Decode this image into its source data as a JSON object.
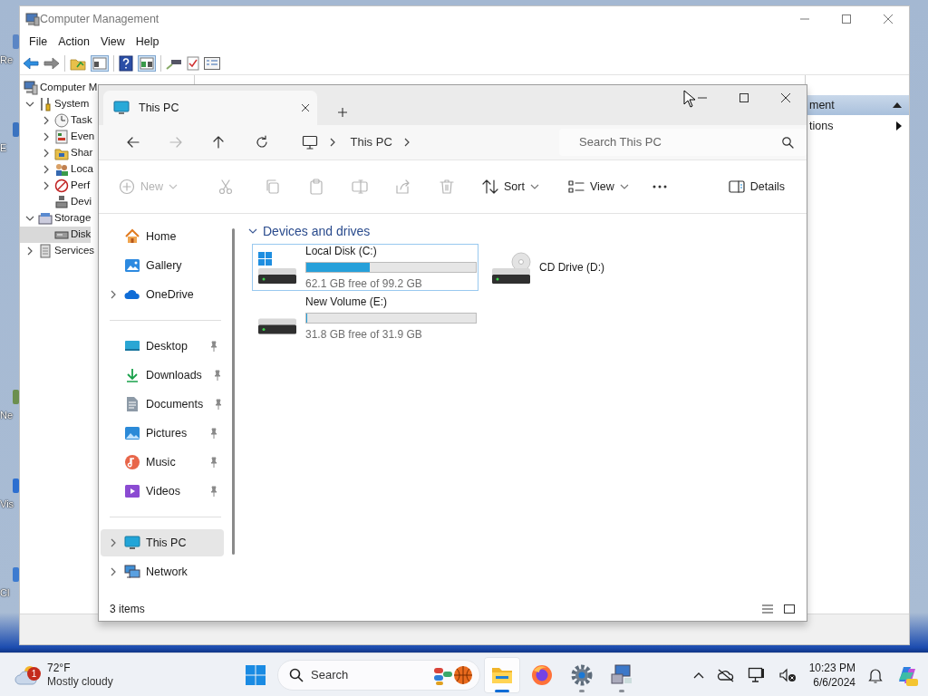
{
  "desktop": {
    "shortcut_labels": [
      "Re",
      "E",
      "Ne",
      "Vis",
      "Cl"
    ]
  },
  "computer_management": {
    "title": "Computer Management",
    "menu": [
      "File",
      "Action",
      "View",
      "Help"
    ],
    "tree": [
      {
        "label": "Computer M",
        "kind": "computer",
        "selected": false,
        "children": [
          {
            "label": "System",
            "kind": "tools",
            "expanded": true,
            "selected": false,
            "children": [
              {
                "label": "Task",
                "kind": "clock",
                "expanded": false,
                "selected": false
              },
              {
                "label": "Even",
                "kind": "event",
                "expanded": false,
                "selected": false
              },
              {
                "label": "Shar",
                "kind": "share",
                "expanded": false,
                "selected": false
              },
              {
                "label": "Loca",
                "kind": "users",
                "expanded": false,
                "selected": false
              },
              {
                "label": "Perf",
                "kind": "perf",
                "expanded": false,
                "selected": false
              },
              {
                "label": "Devi",
                "kind": "device",
                "selected": false
              }
            ]
          },
          {
            "label": "Storage",
            "kind": "storage",
            "expanded": true,
            "selected": false,
            "children": [
              {
                "label": "Disk",
                "kind": "disk",
                "selected": true
              }
            ]
          },
          {
            "label": "Services",
            "kind": "services",
            "expanded": false,
            "selected": false
          }
        ]
      }
    ],
    "actions": [
      {
        "label": "ment",
        "kind": "header"
      },
      {
        "label": "tions",
        "kind": "item"
      }
    ]
  },
  "explorer": {
    "tabs": [
      {
        "label": "This PC",
        "selected": true
      }
    ],
    "breadcrumb": [
      "This PC"
    ],
    "search": {
      "placeholder": "Search This PC"
    },
    "commands": [
      {
        "kind": "new",
        "label": "New",
        "disabled": true,
        "dropdown": true
      },
      {
        "kind": "cut",
        "disabled": true
      },
      {
        "kind": "copy",
        "disabled": true
      },
      {
        "kind": "paste",
        "disabled": true
      },
      {
        "kind": "rename",
        "disabled": true
      },
      {
        "kind": "share",
        "disabled": true
      },
      {
        "kind": "delete",
        "disabled": true
      },
      {
        "kind": "sort",
        "label": "Sort",
        "disabled": false,
        "dropdown": true
      },
      {
        "kind": "view",
        "label": "View",
        "disabled": false,
        "dropdown": true
      },
      {
        "kind": "more",
        "disabled": false
      }
    ],
    "details_label": "Details",
    "nav_sections": [
      {
        "items": [
          {
            "label": "Home",
            "kind": "home",
            "selected": false
          },
          {
            "label": "Gallery",
            "kind": "gallery",
            "selected": false
          },
          {
            "label": "OneDrive",
            "kind": "cloud",
            "expanded": false,
            "selected": false
          }
        ]
      },
      {
        "items": [
          {
            "label": "Desktop",
            "kind": "desktop",
            "pinned": true,
            "selected": false
          },
          {
            "label": "Downloads",
            "kind": "downloads",
            "pinned": true,
            "selected": false
          },
          {
            "label": "Documents",
            "kind": "documents",
            "pinned": true,
            "selected": false
          },
          {
            "label": "Pictures",
            "kind": "pictures",
            "pinned": true,
            "selected": false
          },
          {
            "label": "Music",
            "kind": "music",
            "pinned": true,
            "selected": false
          },
          {
            "label": "Videos",
            "kind": "videos",
            "pinned": true,
            "selected": false
          }
        ]
      },
      {
        "items": [
          {
            "label": "This PC",
            "kind": "pc",
            "expanded": false,
            "selected": true
          },
          {
            "label": "Network",
            "kind": "network",
            "expanded": false,
            "selected": false
          }
        ]
      }
    ],
    "group": {
      "label": "Devices and drives",
      "expanded": true,
      "drives": [
        {
          "label": "Local Disk (C:)",
          "kind": "system",
          "level": 0.374,
          "free": "62.1 GB free of 99.2 GB",
          "selected": true
        },
        {
          "label": "CD Drive (D:)",
          "kind": "optical",
          "selected": false
        },
        {
          "label": "New Volume (E:)",
          "kind": "disk",
          "level": 0.003,
          "free": "31.8 GB free of 31.9 GB",
          "selected": false
        }
      ]
    },
    "status": "3 items"
  },
  "taskbar": {
    "weather": {
      "badge": "1",
      "temperature": "72°F",
      "condition": "Mostly cloudy"
    },
    "search": {
      "label": "Search"
    },
    "apps": [
      {
        "kind": "explorer",
        "running": true,
        "selected": true
      },
      {
        "kind": "firefox",
        "running": false,
        "selected": false
      },
      {
        "kind": "settings",
        "running": true,
        "selected": false
      },
      {
        "kind": "remote",
        "running": true,
        "selected": false
      }
    ],
    "time": "10:23 PM",
    "date": "6/6/2024"
  }
}
